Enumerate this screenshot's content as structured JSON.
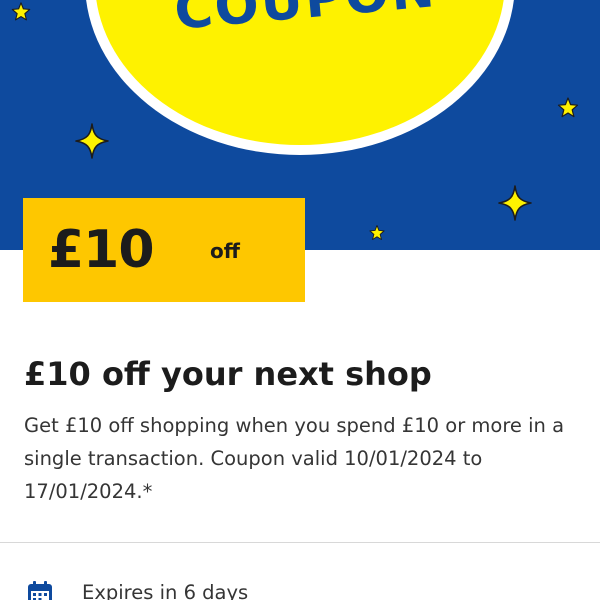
{
  "hero": {
    "badge_text": "COUPON",
    "colors": {
      "background": "#0e4a9e",
      "badge": "#fef200",
      "badge_ring": "#ffffff",
      "stars": "#fef200"
    },
    "icons": [
      "star-icon",
      "sparkle-icon"
    ]
  },
  "price_tag": {
    "amount": "£10",
    "suffix": "off",
    "color": "#fec700"
  },
  "coupon": {
    "title": "£10 off your next shop",
    "description": "Get £10 off shopping when you spend £10 or more in a single transaction. Coupon valid 10/01/2024 to 17/01/2024.*"
  },
  "expiry": {
    "icon": "calendar-icon",
    "text": "Expires in 6 days"
  }
}
